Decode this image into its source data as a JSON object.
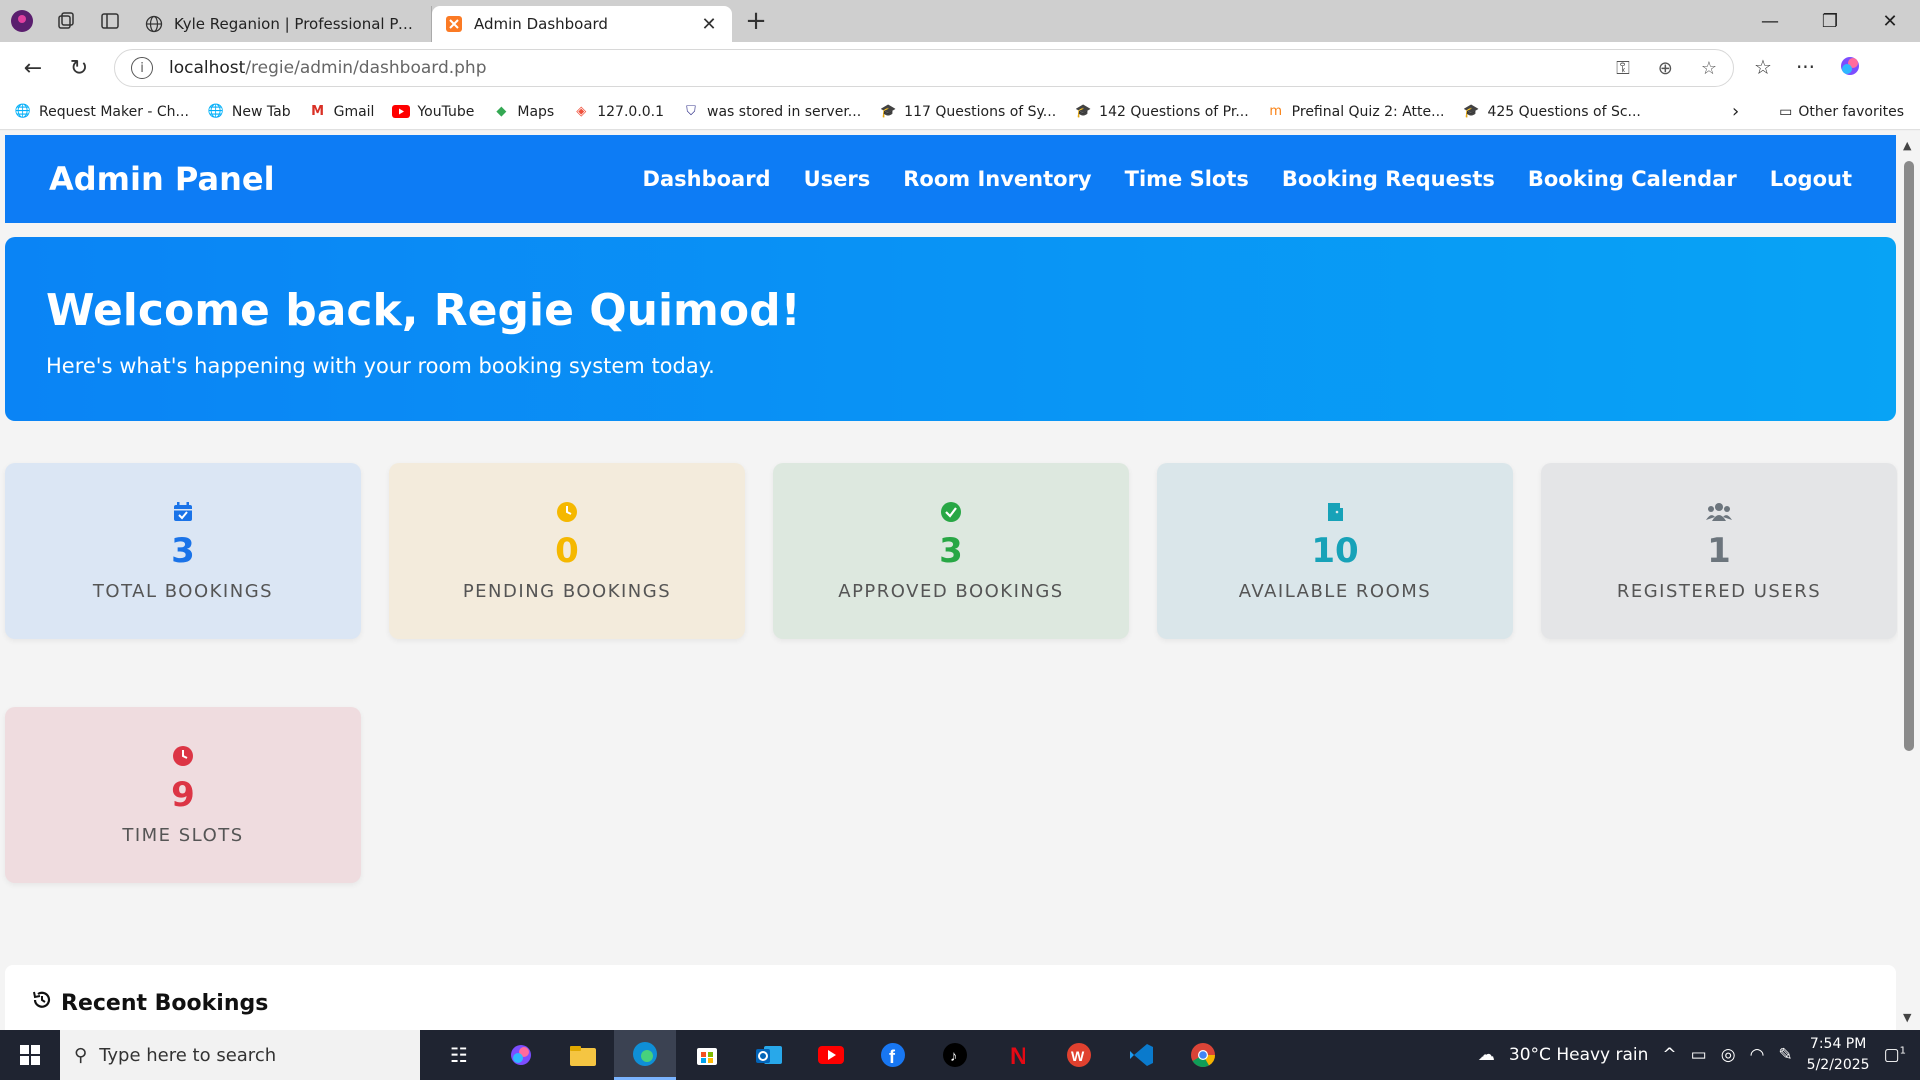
{
  "browser": {
    "tabs": [
      {
        "title": "Kyle Reganion | Professional Portf",
        "active": false
      },
      {
        "title": "Admin Dashboard",
        "active": true
      }
    ],
    "url_host": "localhost",
    "url_path": "/regie/admin/dashboard.php",
    "bookmarks": [
      {
        "label": "Request Maker - Ch...",
        "icon": "globe-icon"
      },
      {
        "label": "New Tab",
        "icon": "globe-icon"
      },
      {
        "label": "Gmail",
        "icon": "gmail-icon"
      },
      {
        "label": "YouTube",
        "icon": "youtube-icon"
      },
      {
        "label": "Maps",
        "icon": "maps-icon"
      },
      {
        "label": "127.0.0.1",
        "icon": "laravel-icon"
      },
      {
        "label": "was stored in server...",
        "icon": "shield-icon"
      },
      {
        "label": "117 Questions of Sy...",
        "icon": "graduation-cap-icon"
      },
      {
        "label": "142 Questions of Pr...",
        "icon": "graduation-cap-icon"
      },
      {
        "label": "Prefinal Quiz 2: Atte...",
        "icon": "moodle-icon"
      },
      {
        "label": "425 Questions of Sc...",
        "icon": "graduation-cap-icon"
      }
    ],
    "other_favorites": "Other favorites"
  },
  "admin": {
    "brand": "Admin Panel",
    "nav": [
      "Dashboard",
      "Users",
      "Room Inventory",
      "Time Slots",
      "Booking Requests",
      "Booking Calendar",
      "Logout"
    ],
    "welcome_title": "Welcome back, Regie Quimod!",
    "welcome_subtitle": "Here's what's happening with your room booking system today.",
    "cards": [
      {
        "value": "3",
        "label": "TOTAL BOOKINGS",
        "icon": "calendar-check-icon",
        "color": "#1a73e8",
        "bg": "#dbe6f4"
      },
      {
        "value": "0",
        "label": "PENDING BOOKINGS",
        "icon": "clock-icon",
        "color": "#f5b800",
        "bg": "#f3ebdc"
      },
      {
        "value": "3",
        "label": "APPROVED BOOKINGS",
        "icon": "check-circle-icon",
        "color": "#28a745",
        "bg": "#dde8df"
      },
      {
        "value": "10",
        "label": "AVAILABLE ROOMS",
        "icon": "door-icon",
        "color": "#17a2b8",
        "bg": "#dae6ea"
      },
      {
        "value": "1",
        "label": "REGISTERED USERS",
        "icon": "users-icon",
        "color": "#6c757d",
        "bg": "#e4e5e7"
      },
      {
        "value": "9",
        "label": "TIME SLOTS",
        "icon": "clock-icon",
        "color": "#dc3545",
        "bg": "#efdcdf"
      }
    ],
    "recent_title": "Recent Bookings"
  },
  "taskbar": {
    "search_placeholder": "Type here to search",
    "weather": "30°C  Heavy rain",
    "time": "7:54 PM",
    "date": "5/2/2025",
    "notification_count": "1"
  }
}
